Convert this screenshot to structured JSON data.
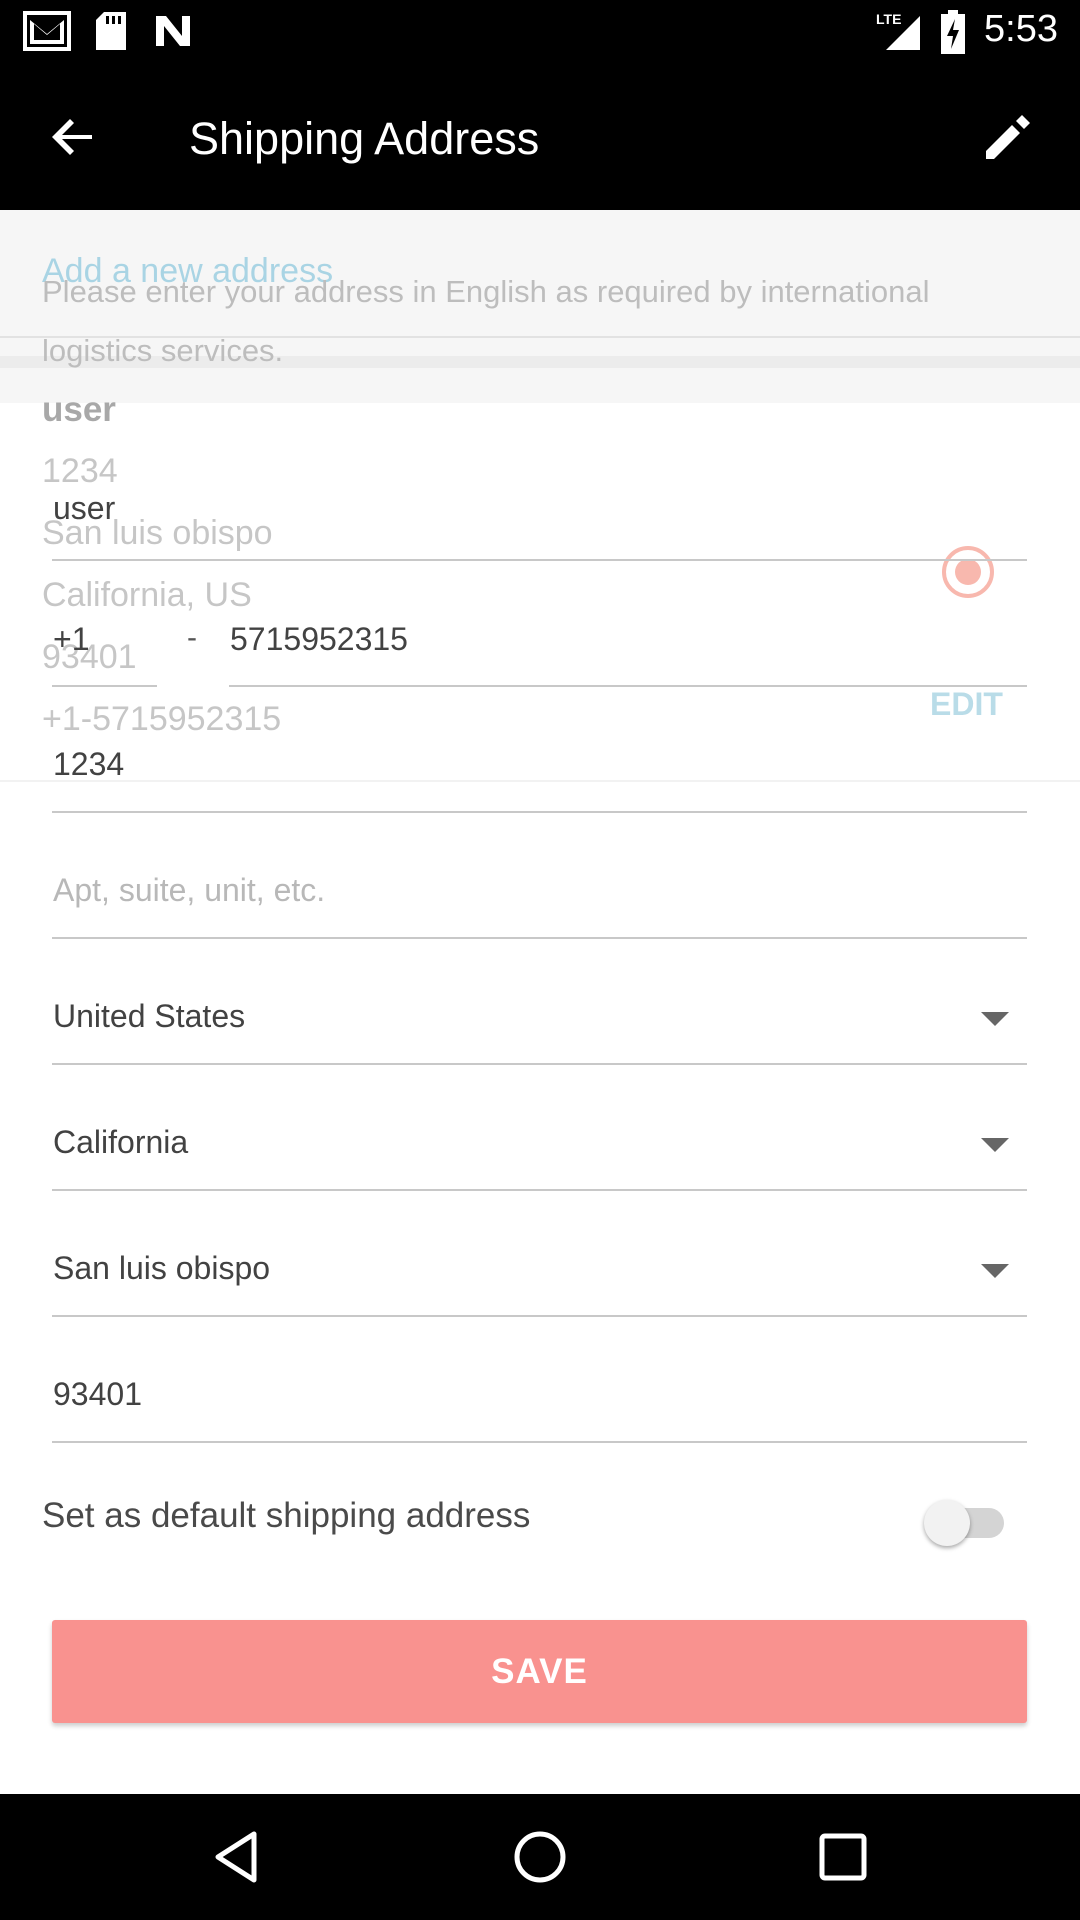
{
  "status_bar": {
    "time": "5:53",
    "icons": [
      "gmail-icon",
      "sd-card-icon",
      "n-icon",
      "lte-signal-icon",
      "battery-charging-icon"
    ]
  },
  "app_bar": {
    "title": "Shipping Address",
    "back_icon": "arrow-back-icon",
    "edit_icon": "pencil-icon"
  },
  "background_card": {
    "add_link": "Add a new address",
    "notice": "Please enter your address in English as required by international logistics services.",
    "name": "user",
    "address_line": "1234",
    "city": "San luis obispo",
    "state_country": "California, US",
    "zip": "93401",
    "phone": "+1-5715952315",
    "edit_label": "EDIT"
  },
  "form": {
    "name": "user",
    "phone_code": "+1",
    "phone_separator": "-",
    "phone_number": "5715952315",
    "street": "1234",
    "apt_placeholder": "Apt, suite, unit, etc.",
    "country": "United States",
    "state": "California",
    "city": "San luis obispo",
    "zip": "93401",
    "default_label": "Set as default shipping address",
    "default_enabled": false,
    "save_label": "SAVE"
  },
  "colors": {
    "accent": "#f9928f",
    "link": "#a9d4e4",
    "bars": "#000000"
  },
  "nav_bar": {
    "icons": [
      "back-triangle-icon",
      "home-circle-icon",
      "recents-square-icon"
    ]
  }
}
